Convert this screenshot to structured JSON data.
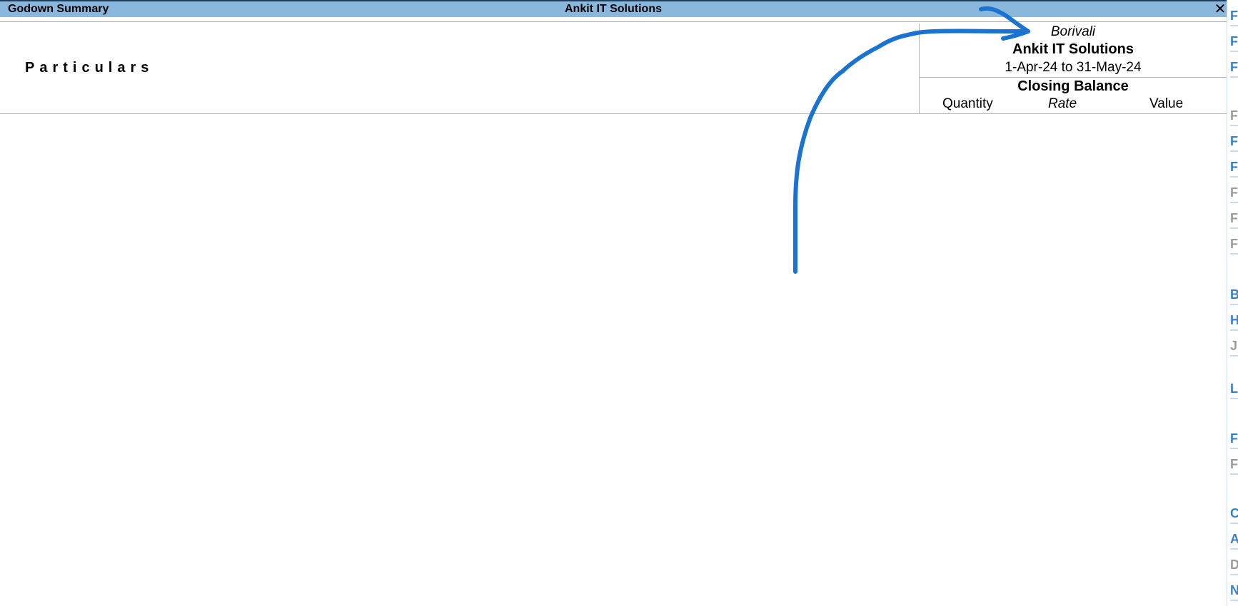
{
  "window": {
    "report_title": "Godown Summary",
    "company_title": "Ankit IT Solutions",
    "close_glyph": "✕"
  },
  "header": {
    "particulars_label": "Particulars",
    "godown_name": "Borivali",
    "company_name": "Ankit IT Solutions",
    "period": "1-Apr-24 to 31-May-24",
    "closing_balance_label": "Closing Balance",
    "columns": {
      "quantity": "Quantity",
      "rate": "Rate",
      "value": "Value"
    }
  },
  "right_strip": {
    "buttons": [
      {
        "label": "F",
        "state": "active"
      },
      {
        "label": "F",
        "state": "active"
      },
      {
        "label": "F",
        "state": "active"
      },
      {
        "label": "F",
        "state": "inactive"
      },
      {
        "label": "F",
        "state": "active"
      },
      {
        "label": "F",
        "state": "active"
      },
      {
        "label": "F",
        "state": "inactive"
      },
      {
        "label": "F",
        "state": "inactive"
      },
      {
        "label": "F",
        "state": "inactive"
      },
      {
        "label": "B",
        "state": "active"
      },
      {
        "label": "H",
        "state": "active"
      },
      {
        "label": "J",
        "state": "inactive"
      },
      {
        "label": "L",
        "state": "active"
      },
      {
        "label": "F",
        "state": "active"
      },
      {
        "label": "F",
        "state": "inactive"
      },
      {
        "label": "C",
        "state": "active"
      },
      {
        "label": "A",
        "state": "active"
      },
      {
        "label": "D",
        "state": "inactive"
      },
      {
        "label": "N",
        "state": "active"
      }
    ]
  },
  "colors": {
    "titlebar": "#8ab7dc",
    "annotation_arrow": "#1a73d1",
    "strip_active": "#3a7fc6",
    "strip_inactive": "#9b9b9b"
  }
}
